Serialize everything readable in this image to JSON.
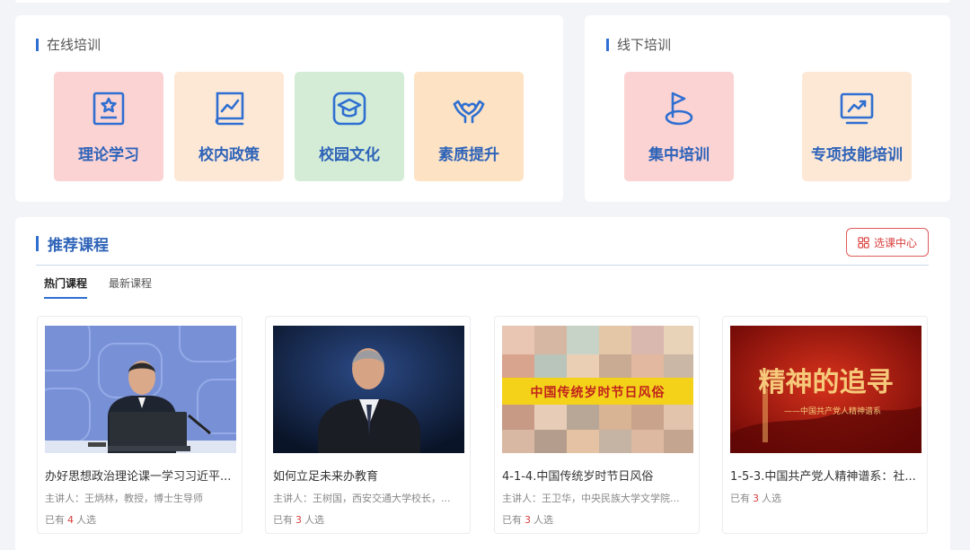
{
  "online": {
    "title": "在线培训",
    "tiles": [
      {
        "label": "理论学习",
        "icon": "certificate-star-icon",
        "bg": "#fbd3d3"
      },
      {
        "label": "校内政策",
        "icon": "chart-book-icon",
        "bg": "#fde8d6"
      },
      {
        "label": "校园文化",
        "icon": "graduation-cap-icon",
        "bg": "#d4ecd6"
      },
      {
        "label": "素质提升",
        "icon": "hands-heart-icon",
        "bg": "#fde3c4"
      }
    ]
  },
  "offline": {
    "title": "线下培训",
    "tiles": [
      {
        "label": "集中培训",
        "icon": "flag-icon",
        "bg": "#fbd3d3"
      },
      {
        "label": "专项技能培训",
        "icon": "trend-monitor-icon",
        "bg": "#fde8d6"
      }
    ]
  },
  "recommended": {
    "title": "推荐课程",
    "select_center": "选课中心",
    "tabs": [
      "热门课程",
      "最新课程"
    ],
    "courses": [
      {
        "title": "办好思想政治理论课一学习习近平...",
        "lecturer": "主讲人：王炳林，教授，博士生导师",
        "enroll_prefix": "已有",
        "enroll_count": "4",
        "enroll_suffix": "人选"
      },
      {
        "title": "如何立足未来办教育",
        "lecturer": "主讲人：王树国，西安交通大学校长，...",
        "enroll_prefix": "已有",
        "enroll_count": "3",
        "enroll_suffix": "人选"
      },
      {
        "title": "4-1-4.中国传统岁时节日风俗",
        "lecturer": "主讲人：王卫华，中央民族大学文学院...",
        "enroll_prefix": "已有",
        "enroll_count": "3",
        "enroll_suffix": "人选",
        "banner": "中国传统岁时节日风俗"
      },
      {
        "title": "1-5-3.中国共产党人精神谱系：社...",
        "lecturer": "",
        "enroll_prefix": "已有",
        "enroll_count": "3",
        "enroll_suffix": "人选",
        "banner": "精神的追寻",
        "banner_sub": "——中国共产党人精神谱系"
      }
    ]
  },
  "colors": {
    "accent": "#2f6fd1",
    "red": "#d9403f"
  }
}
